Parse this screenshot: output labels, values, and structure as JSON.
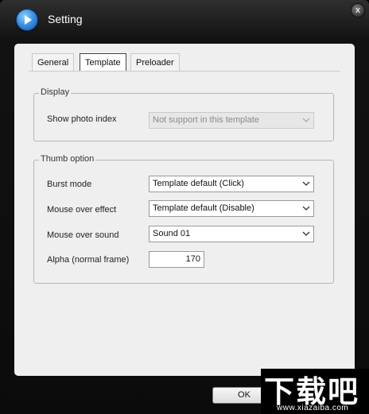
{
  "window": {
    "title": "Setting",
    "close_glyph": "x"
  },
  "tabs": [
    {
      "label": "General",
      "active": false
    },
    {
      "label": "Template",
      "active": true
    },
    {
      "label": "Preloader",
      "active": false
    }
  ],
  "display": {
    "legend": "Display",
    "show_photo_index_label": "Show photo index",
    "show_photo_index_value": "Not support in this template"
  },
  "thumb": {
    "legend": "Thumb option",
    "burst_label": "Burst mode",
    "burst_value": "Template default (Click)",
    "mouse_effect_label": "Mouse over effect",
    "mouse_effect_value": "Template default (Disable)",
    "mouse_sound_label": "Mouse over sound",
    "mouse_sound_value": "Sound 01",
    "alpha_label": "Alpha (normal frame)",
    "alpha_value": "170"
  },
  "buttons": {
    "ok": "OK"
  },
  "watermark": {
    "big": "下载吧",
    "small": "www.xiazaiba.com"
  },
  "icons": {
    "app": "play-icon",
    "close": "close-icon",
    "dropdown": "chevron-down-icon"
  }
}
